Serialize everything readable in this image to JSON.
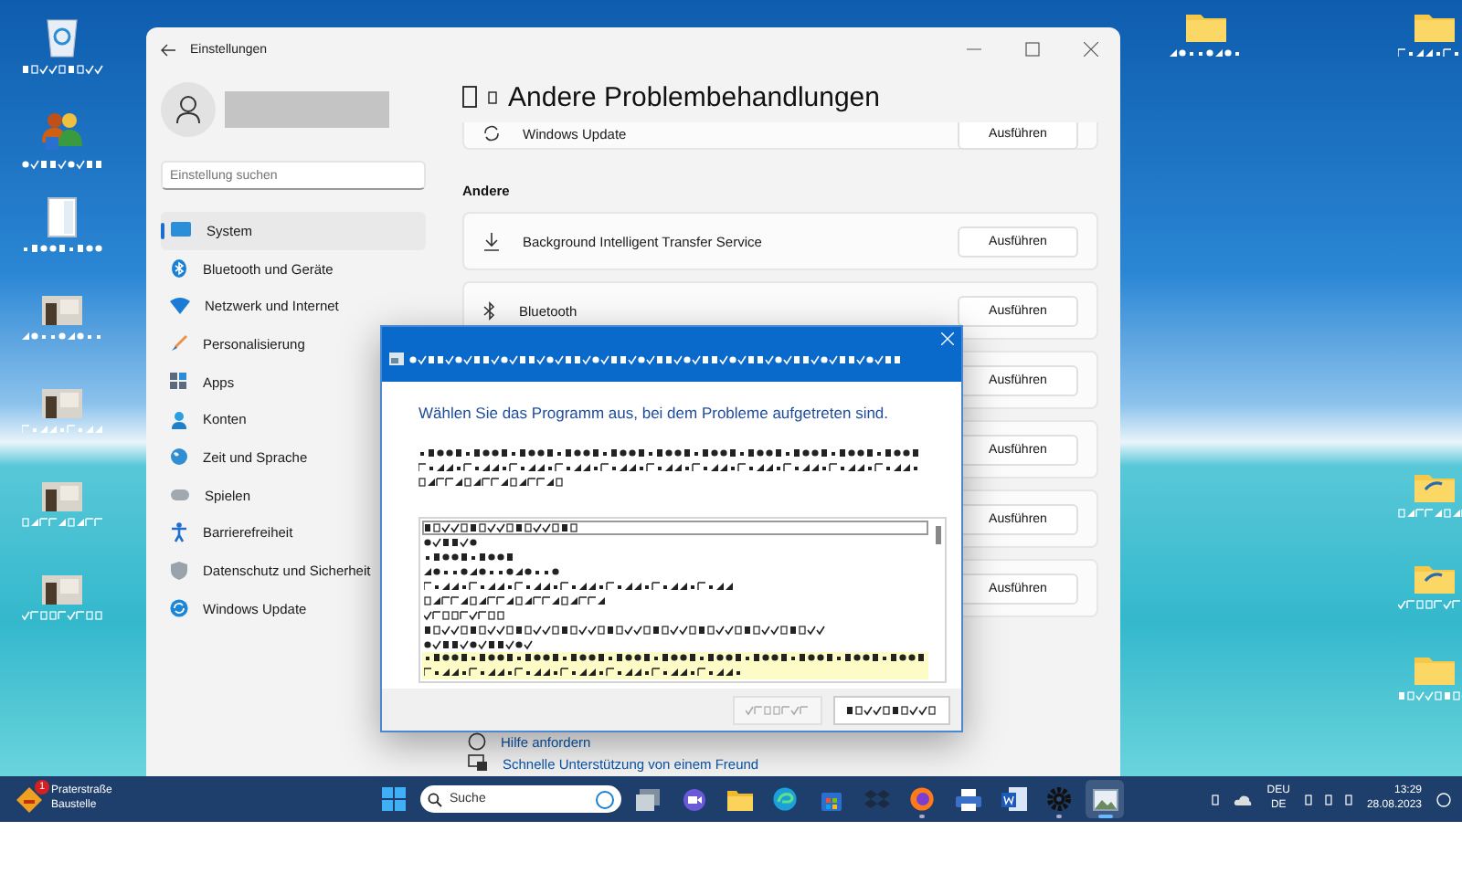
{
  "desktop": {
    "left_icons": [
      {
        "kind": "recycle-bin"
      },
      {
        "kind": "users"
      },
      {
        "kind": "document"
      },
      {
        "kind": "photo"
      },
      {
        "kind": "photo"
      },
      {
        "kind": "photo"
      },
      {
        "kind": "photo"
      }
    ],
    "right_icons": [
      {
        "kind": "folder"
      },
      {
        "kind": "folder"
      },
      {
        "kind": "folder-shortcut"
      },
      {
        "kind": "folder-shortcut"
      },
      {
        "kind": "folder"
      }
    ]
  },
  "settings": {
    "title": "Einstellungen",
    "search": {
      "placeholder": "Einstellung suchen"
    },
    "nav": [
      {
        "label": "System",
        "kind": "system",
        "selected": true
      },
      {
        "label": "Bluetooth und Geräte",
        "kind": "bluetooth",
        "selected": false
      },
      {
        "label": "Netzwerk und Internet",
        "kind": "wifi",
        "selected": false
      },
      {
        "label": "Personalisierung",
        "kind": "brush",
        "selected": false
      },
      {
        "label": "Apps",
        "kind": "apps",
        "selected": false
      },
      {
        "label": "Konten",
        "kind": "account",
        "selected": false
      },
      {
        "label": "Zeit und Sprache",
        "kind": "globe",
        "selected": false
      },
      {
        "label": "Spielen",
        "kind": "gamepad",
        "selected": false
      },
      {
        "label": "Barrierefreiheit",
        "kind": "accessibility",
        "selected": false
      },
      {
        "label": "Datenschutz und Sicherheit",
        "kind": "shield",
        "selected": false
      },
      {
        "label": "Windows Update",
        "kind": "update",
        "selected": false
      }
    ],
    "heading": "Andere Problembehandlungen",
    "top_card": {
      "title": "Windows Update",
      "kind": "update",
      "button": "Ausführen"
    },
    "section": "Andere",
    "cards": [
      {
        "title": "Background Intelligent Transfer Service",
        "kind": "download",
        "button": "Ausführen"
      },
      {
        "title": "Bluetooth",
        "kind": "bluetooth",
        "button": "Ausführen"
      },
      {
        "button": "Ausführen"
      },
      {
        "button": "Ausführen"
      },
      {
        "button": "Ausführen"
      },
      {
        "button": "Ausführen"
      }
    ],
    "links": [
      {
        "label": "Hilfe anfordern",
        "kind": "help"
      },
      {
        "label": "Schnelle Unterstützung von einem Freund",
        "kind": "remote"
      }
    ]
  },
  "dialog": {
    "prompt": "Wählen Sie das Programm aus, bei dem Probleme aufgetreten sind.",
    "list_rows": [
      {
        "selected": false
      },
      {
        "selected": false
      },
      {
        "selected": false
      },
      {
        "selected": false
      },
      {
        "selected": false
      },
      {
        "selected": false
      },
      {
        "selected": false
      },
      {
        "selected": false
      },
      {
        "selected": false
      },
      {
        "selected": true
      }
    ],
    "buttons": [
      {
        "disabled": true
      },
      {
        "disabled": false
      }
    ]
  },
  "taskbar": {
    "weather": {
      "badge": "1",
      "title": "Praterstraße",
      "subtitle": "Baustelle"
    },
    "search": {
      "placeholder": "Suche"
    },
    "apps": [
      {
        "kind": "window",
        "running": false,
        "active": false
      },
      {
        "kind": "camera",
        "running": false,
        "active": false
      },
      {
        "kind": "folder",
        "running": false,
        "active": false
      },
      {
        "kind": "browser",
        "running": false,
        "active": false
      },
      {
        "kind": "store",
        "running": false,
        "active": false
      },
      {
        "kind": "dropbox",
        "running": false,
        "active": false
      },
      {
        "kind": "firefox",
        "running": true,
        "active": false
      },
      {
        "kind": "printer",
        "running": false,
        "active": false
      },
      {
        "kind": "word",
        "running": false,
        "active": false
      },
      {
        "kind": "gear",
        "running": true,
        "active": false
      },
      {
        "kind": "image",
        "running": true,
        "active": true
      }
    ],
    "language": {
      "line1": "DEU",
      "line2": "DE"
    },
    "time": "13:29",
    "date": "28.08.2023"
  }
}
